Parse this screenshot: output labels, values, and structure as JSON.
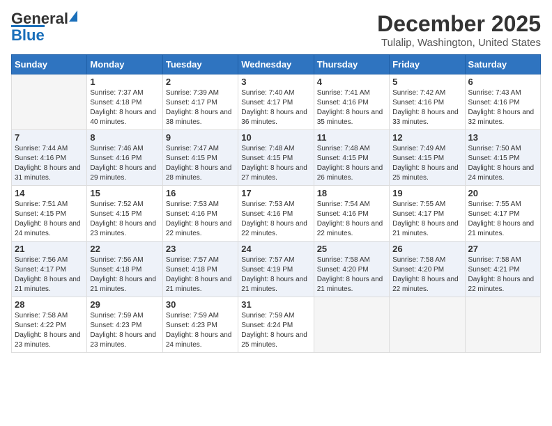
{
  "header": {
    "logo_general": "General",
    "logo_blue": "Blue",
    "title": "December 2025",
    "subtitle": "Tulalip, Washington, United States"
  },
  "columns": [
    "Sunday",
    "Monday",
    "Tuesday",
    "Wednesday",
    "Thursday",
    "Friday",
    "Saturday"
  ],
  "weeks": [
    [
      {
        "day": "",
        "sunrise": "",
        "sunset": "",
        "daylight": ""
      },
      {
        "day": "1",
        "sunrise": "Sunrise: 7:37 AM",
        "sunset": "Sunset: 4:18 PM",
        "daylight": "Daylight: 8 hours and 40 minutes."
      },
      {
        "day": "2",
        "sunrise": "Sunrise: 7:39 AM",
        "sunset": "Sunset: 4:17 PM",
        "daylight": "Daylight: 8 hours and 38 minutes."
      },
      {
        "day": "3",
        "sunrise": "Sunrise: 7:40 AM",
        "sunset": "Sunset: 4:17 PM",
        "daylight": "Daylight: 8 hours and 36 minutes."
      },
      {
        "day": "4",
        "sunrise": "Sunrise: 7:41 AM",
        "sunset": "Sunset: 4:16 PM",
        "daylight": "Daylight: 8 hours and 35 minutes."
      },
      {
        "day": "5",
        "sunrise": "Sunrise: 7:42 AM",
        "sunset": "Sunset: 4:16 PM",
        "daylight": "Daylight: 8 hours and 33 minutes."
      },
      {
        "day": "6",
        "sunrise": "Sunrise: 7:43 AM",
        "sunset": "Sunset: 4:16 PM",
        "daylight": "Daylight: 8 hours and 32 minutes."
      }
    ],
    [
      {
        "day": "7",
        "sunrise": "Sunrise: 7:44 AM",
        "sunset": "Sunset: 4:16 PM",
        "daylight": "Daylight: 8 hours and 31 minutes."
      },
      {
        "day": "8",
        "sunrise": "Sunrise: 7:46 AM",
        "sunset": "Sunset: 4:16 PM",
        "daylight": "Daylight: 8 hours and 29 minutes."
      },
      {
        "day": "9",
        "sunrise": "Sunrise: 7:47 AM",
        "sunset": "Sunset: 4:15 PM",
        "daylight": "Daylight: 8 hours and 28 minutes."
      },
      {
        "day": "10",
        "sunrise": "Sunrise: 7:48 AM",
        "sunset": "Sunset: 4:15 PM",
        "daylight": "Daylight: 8 hours and 27 minutes."
      },
      {
        "day": "11",
        "sunrise": "Sunrise: 7:48 AM",
        "sunset": "Sunset: 4:15 PM",
        "daylight": "Daylight: 8 hours and 26 minutes."
      },
      {
        "day": "12",
        "sunrise": "Sunrise: 7:49 AM",
        "sunset": "Sunset: 4:15 PM",
        "daylight": "Daylight: 8 hours and 25 minutes."
      },
      {
        "day": "13",
        "sunrise": "Sunrise: 7:50 AM",
        "sunset": "Sunset: 4:15 PM",
        "daylight": "Daylight: 8 hours and 24 minutes."
      }
    ],
    [
      {
        "day": "14",
        "sunrise": "Sunrise: 7:51 AM",
        "sunset": "Sunset: 4:15 PM",
        "daylight": "Daylight: 8 hours and 24 minutes."
      },
      {
        "day": "15",
        "sunrise": "Sunrise: 7:52 AM",
        "sunset": "Sunset: 4:15 PM",
        "daylight": "Daylight: 8 hours and 23 minutes."
      },
      {
        "day": "16",
        "sunrise": "Sunrise: 7:53 AM",
        "sunset": "Sunset: 4:16 PM",
        "daylight": "Daylight: 8 hours and 22 minutes."
      },
      {
        "day": "17",
        "sunrise": "Sunrise: 7:53 AM",
        "sunset": "Sunset: 4:16 PM",
        "daylight": "Daylight: 8 hours and 22 minutes."
      },
      {
        "day": "18",
        "sunrise": "Sunrise: 7:54 AM",
        "sunset": "Sunset: 4:16 PM",
        "daylight": "Daylight: 8 hours and 22 minutes."
      },
      {
        "day": "19",
        "sunrise": "Sunrise: 7:55 AM",
        "sunset": "Sunset: 4:17 PM",
        "daylight": "Daylight: 8 hours and 21 minutes."
      },
      {
        "day": "20",
        "sunrise": "Sunrise: 7:55 AM",
        "sunset": "Sunset: 4:17 PM",
        "daylight": "Daylight: 8 hours and 21 minutes."
      }
    ],
    [
      {
        "day": "21",
        "sunrise": "Sunrise: 7:56 AM",
        "sunset": "Sunset: 4:17 PM",
        "daylight": "Daylight: 8 hours and 21 minutes."
      },
      {
        "day": "22",
        "sunrise": "Sunrise: 7:56 AM",
        "sunset": "Sunset: 4:18 PM",
        "daylight": "Daylight: 8 hours and 21 minutes."
      },
      {
        "day": "23",
        "sunrise": "Sunrise: 7:57 AM",
        "sunset": "Sunset: 4:18 PM",
        "daylight": "Daylight: 8 hours and 21 minutes."
      },
      {
        "day": "24",
        "sunrise": "Sunrise: 7:57 AM",
        "sunset": "Sunset: 4:19 PM",
        "daylight": "Daylight: 8 hours and 21 minutes."
      },
      {
        "day": "25",
        "sunrise": "Sunrise: 7:58 AM",
        "sunset": "Sunset: 4:20 PM",
        "daylight": "Daylight: 8 hours and 21 minutes."
      },
      {
        "day": "26",
        "sunrise": "Sunrise: 7:58 AM",
        "sunset": "Sunset: 4:20 PM",
        "daylight": "Daylight: 8 hours and 22 minutes."
      },
      {
        "day": "27",
        "sunrise": "Sunrise: 7:58 AM",
        "sunset": "Sunset: 4:21 PM",
        "daylight": "Daylight: 8 hours and 22 minutes."
      }
    ],
    [
      {
        "day": "28",
        "sunrise": "Sunrise: 7:58 AM",
        "sunset": "Sunset: 4:22 PM",
        "daylight": "Daylight: 8 hours and 23 minutes."
      },
      {
        "day": "29",
        "sunrise": "Sunrise: 7:59 AM",
        "sunset": "Sunset: 4:23 PM",
        "daylight": "Daylight: 8 hours and 23 minutes."
      },
      {
        "day": "30",
        "sunrise": "Sunrise: 7:59 AM",
        "sunset": "Sunset: 4:23 PM",
        "daylight": "Daylight: 8 hours and 24 minutes."
      },
      {
        "day": "31",
        "sunrise": "Sunrise: 7:59 AM",
        "sunset": "Sunset: 4:24 PM",
        "daylight": "Daylight: 8 hours and 25 minutes."
      },
      {
        "day": "",
        "sunrise": "",
        "sunset": "",
        "daylight": ""
      },
      {
        "day": "",
        "sunrise": "",
        "sunset": "",
        "daylight": ""
      },
      {
        "day": "",
        "sunrise": "",
        "sunset": "",
        "daylight": ""
      }
    ]
  ]
}
